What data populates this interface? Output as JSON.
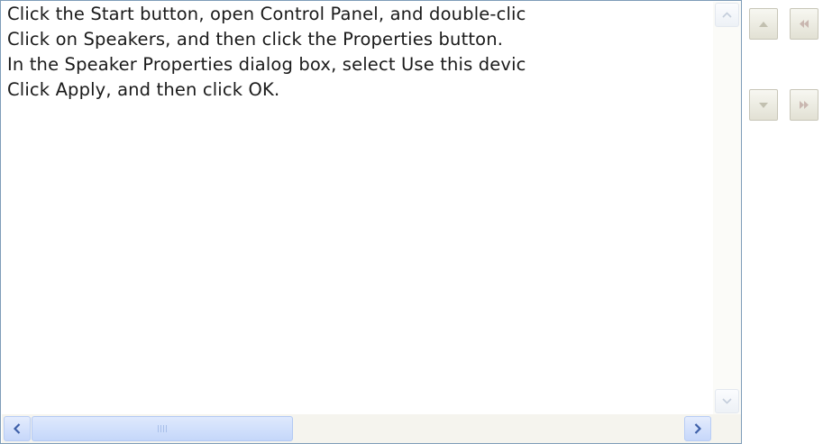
{
  "list": {
    "items": [
      "Click the Start button, open Control Panel, and double-click Sounds and Audio Devices.",
      "Click on Speakers, and then click the Properties button.",
      "In the Speaker Properties dialog box, select Use this device (enable).",
      "Click Apply, and then click OK."
    ],
    "visible_items": [
      "Click the Start button, open Control Panel, and double-clic",
      "Click on Speakers, and then click the Properties button.",
      "In the Speaker Properties dialog box, select Use this devic",
      "Click Apply, and then click OK."
    ],
    "vertical_scrollbar": {
      "up_icon": "scroll-up-arrow",
      "down_icon": "scroll-down-arrow"
    },
    "horizontal_scrollbar": {
      "left_icon": "scroll-left-arrow",
      "right_icon": "scroll-right-arrow",
      "thumb_icon": "grip-lines"
    }
  },
  "controls": {
    "move_up_icon": "triangle-up",
    "move_down_icon": "triangle-down",
    "move_to_top_icon": "double-left-arrow",
    "move_to_bottom_icon": "double-right-arrow"
  },
  "colors": {
    "list_border": "#7f9db9",
    "scroll_thumb": "#c5d7fa",
    "control_button": "#e2e1d4"
  }
}
